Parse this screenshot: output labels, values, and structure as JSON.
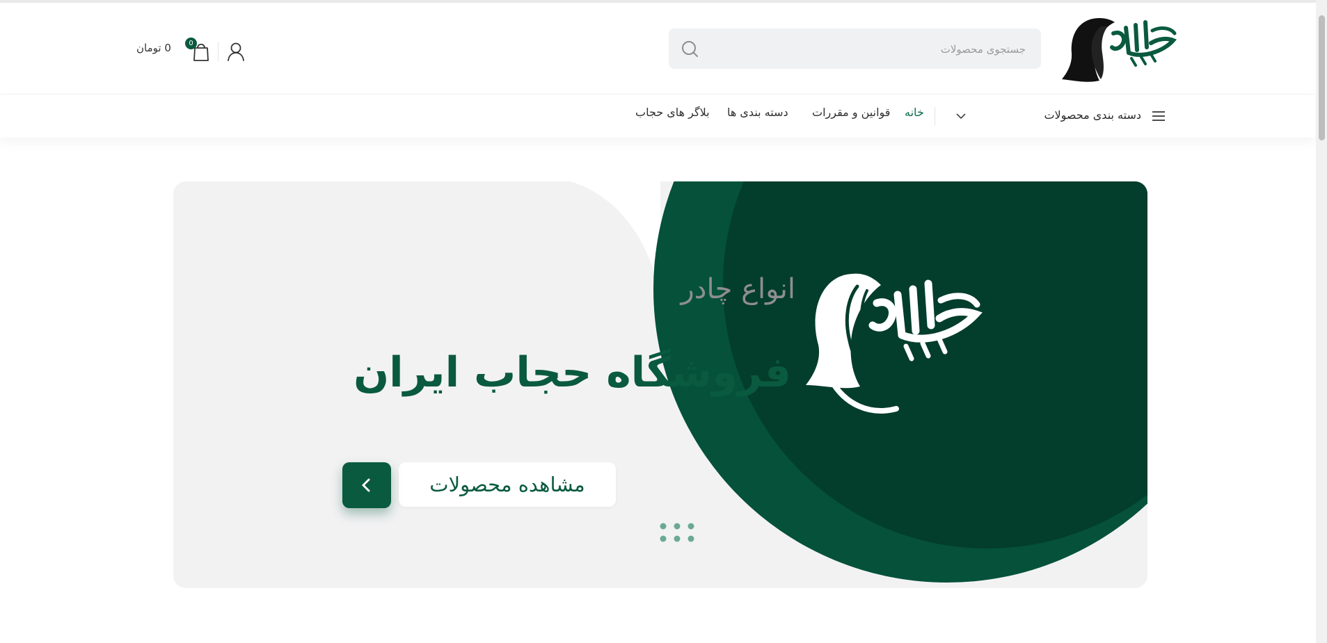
{
  "colors": {
    "brand_green": "#0a5a3f",
    "brand_green_dark": "#033d2c",
    "brand_green_mid": "#05513a",
    "hero_bg": "#f2f2f3",
    "dots": "#6aa995"
  },
  "header": {
    "logo_icon": "hijab-logo-icon",
    "search": {
      "placeholder": "جستجوی محصولات",
      "value": "",
      "icon": "search-icon"
    },
    "account_icon": "user-icon",
    "cart": {
      "icon": "shopping-bag-icon",
      "count": "0",
      "total": "0 تومان"
    }
  },
  "nav": {
    "categories_label": "دسته بندی محصولات",
    "categories_icon": "hamburger-icon",
    "dropdown_icon": "chevron-down-icon",
    "links": [
      {
        "label": "خانه",
        "active": true
      },
      {
        "label": "قوانین و مقررات",
        "active": false
      },
      {
        "label": "دسته بندی ها",
        "active": false
      },
      {
        "label": "بلاگر های حجاب",
        "active": false
      }
    ]
  },
  "hero": {
    "subtitle": "انواع چادر",
    "title": "فروشگاه حجاب ایران",
    "cta_label": "مشاهده محصولات",
    "cta_arrow_icon": "chevron-left-icon",
    "image_icon": "hijab-logo-icon",
    "carousel_dots": 6
  }
}
